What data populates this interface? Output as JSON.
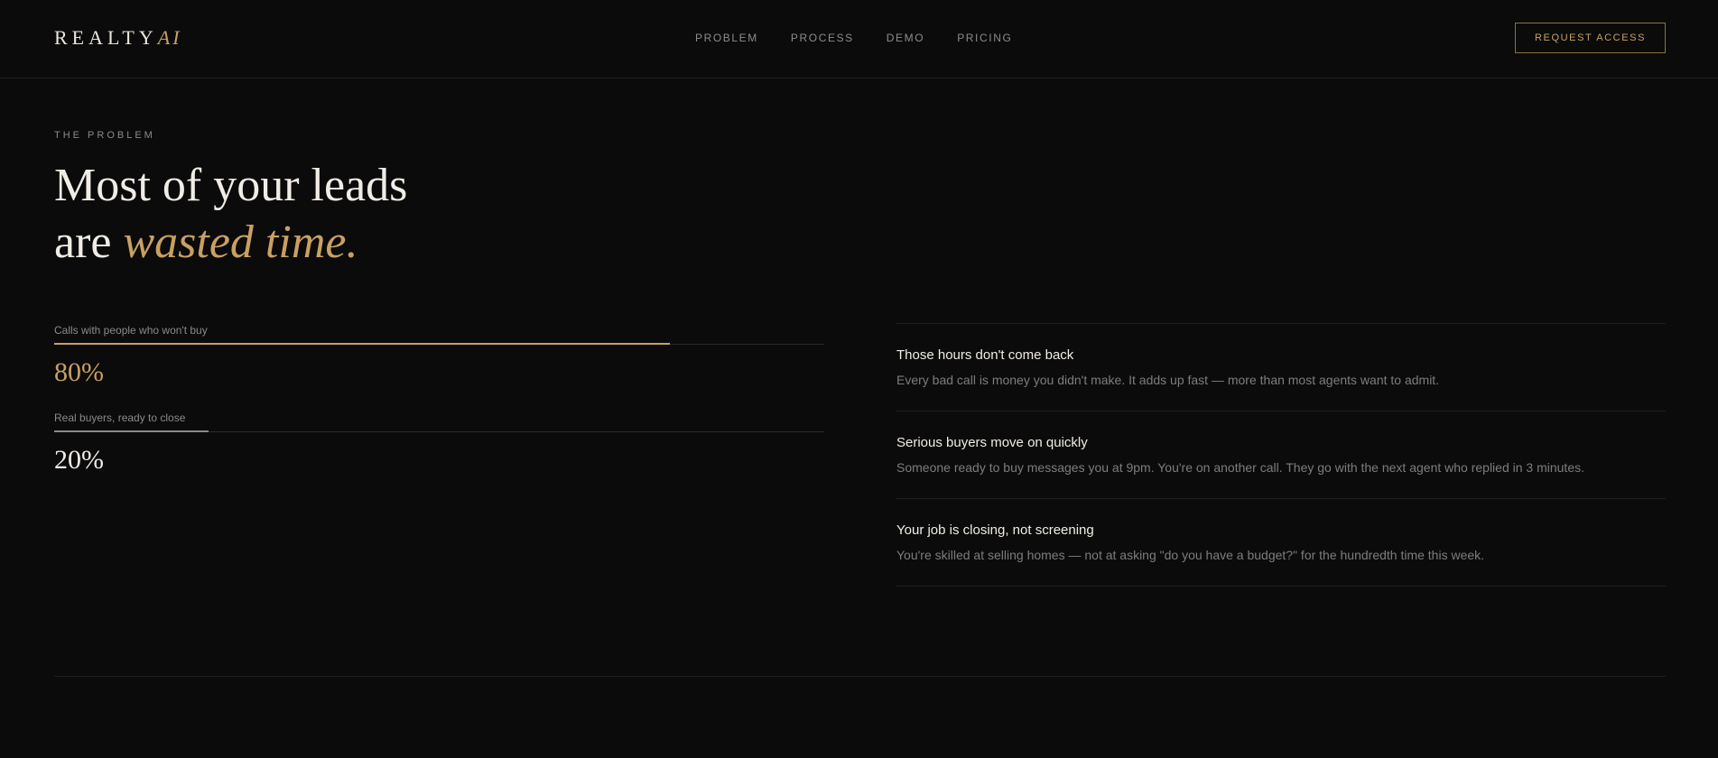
{
  "brand": {
    "name": "REALTY",
    "accent": "AI"
  },
  "nav": {
    "items": [
      {
        "id": "problem",
        "label": "PROBLEM"
      },
      {
        "id": "process",
        "label": "PROCESS"
      },
      {
        "id": "demo",
        "label": "DEMO"
      },
      {
        "id": "pricing",
        "label": "PRICING"
      }
    ]
  },
  "header": {
    "cta_label": "REQUEST ACCESS"
  },
  "hero": {
    "eyebrow": "THE PROBLEM",
    "line1": "Most of your leads",
    "line2_prefix": "are ",
    "line2_accent": "wasted time."
  },
  "stats": [
    {
      "label": "Calls with people who won't buy",
      "value": "80%",
      "fraction": 0.8,
      "color": "#c9a063"
    },
    {
      "label": "Real buyers, ready to close",
      "value": "20%",
      "fraction": 0.2,
      "color": "#8a8a8a"
    }
  ],
  "points": [
    {
      "title": "Those hours don't come back",
      "body": "Every bad call is money you didn't make. It adds up fast — more than most agents want to admit."
    },
    {
      "title": "Serious buyers move on quickly",
      "body": "Someone ready to buy messages you at 9pm. You're on another call. They go with the next agent who replied in 3 minutes."
    },
    {
      "title": "Your job is closing, not screening",
      "body": "You're skilled at selling homes — not at asking \"do you have a budget?\" for the hundredth time this week."
    }
  ],
  "colors": {
    "background": "#0b0b0b",
    "accent": "#c9a063",
    "text": "#f1ede6",
    "muted": "#7d7d7d"
  }
}
